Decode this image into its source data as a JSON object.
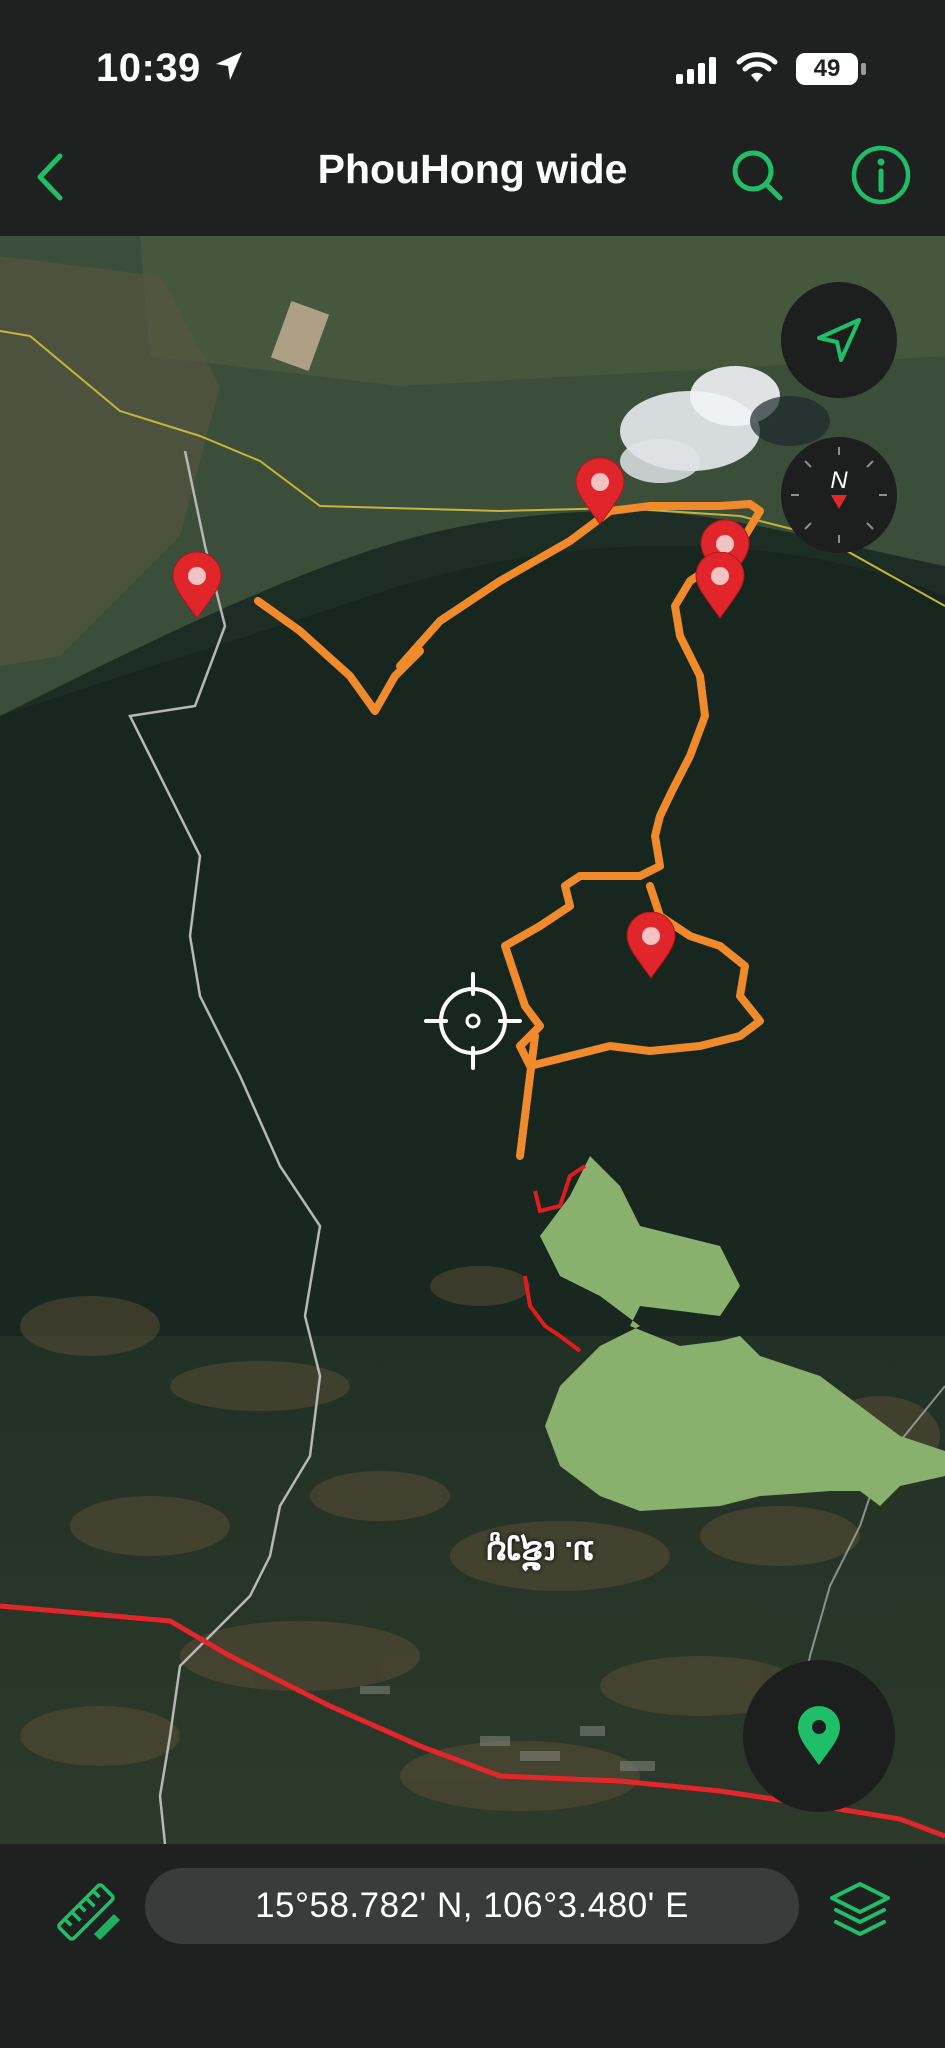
{
  "status": {
    "time": "10:39",
    "battery": "49"
  },
  "nav": {
    "title": "PhouHong wide"
  },
  "map": {
    "place_label": "ນ. ເຊັງບູ"
  },
  "bottom": {
    "coordinates": "15°58.782' N, 106°3.480' E"
  },
  "colors": {
    "accent": "#1fbf6a",
    "track_primary": "#f08a2a",
    "track_secondary": "#e01c1c",
    "road": "#e4262a",
    "marker": "#e0262b"
  },
  "icons": {
    "back": "chevron-left-icon",
    "search": "search-icon",
    "info": "info-icon",
    "location_arrow": "location-arrow-icon",
    "compass": "compass-icon",
    "crosshair": "crosshair-icon",
    "add_pin": "map-pin-icon",
    "ruler": "ruler-icon",
    "layers": "layers-icon"
  }
}
